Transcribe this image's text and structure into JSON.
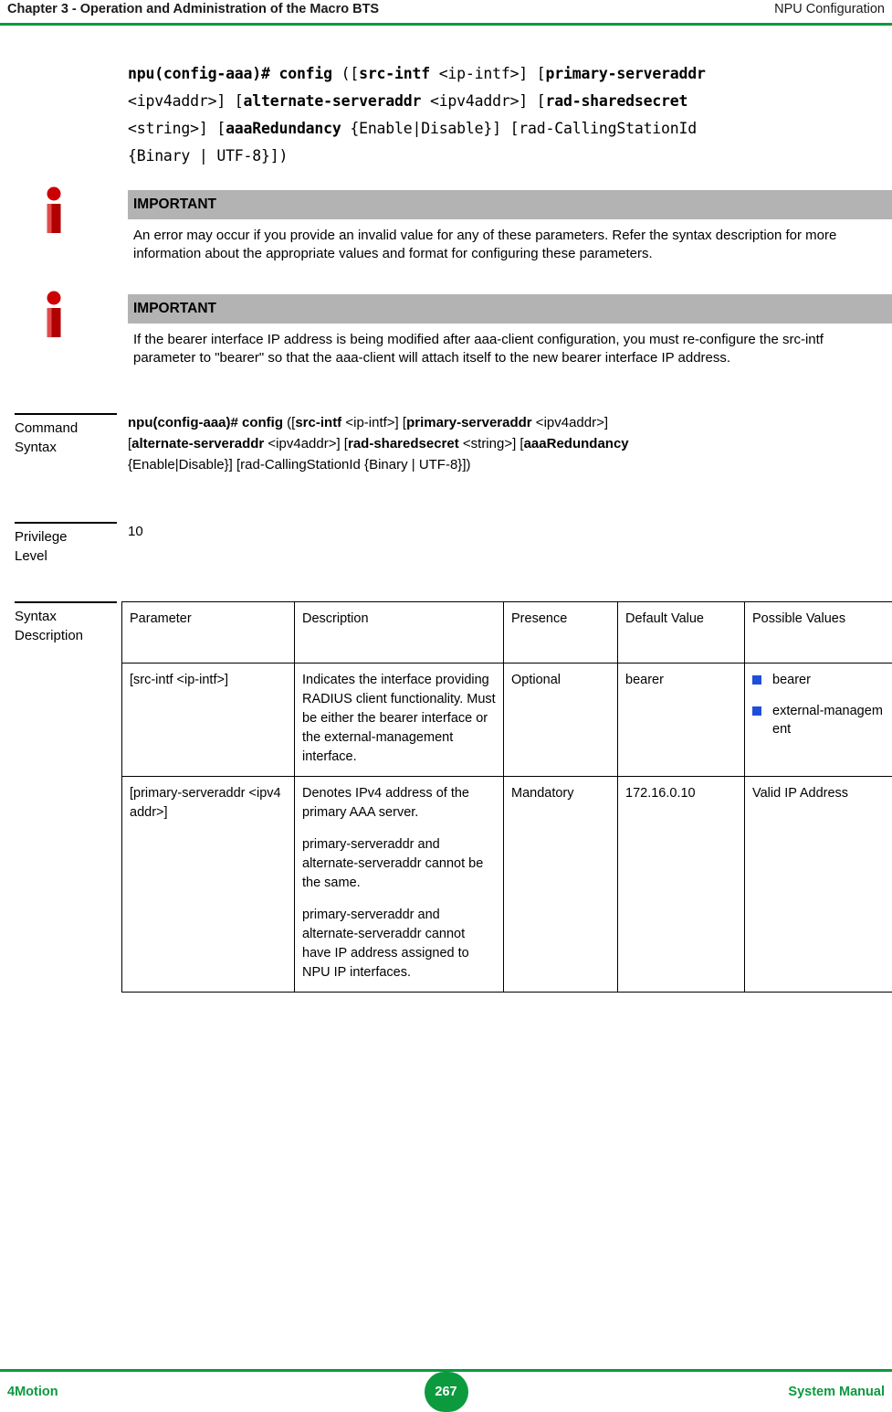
{
  "header": {
    "left": "Chapter 3 - Operation and Administration of the Macro BTS",
    "right": "NPU Configuration"
  },
  "footer": {
    "left": "4Motion",
    "page_number": "267",
    "right": "System Manual"
  },
  "code_block": {
    "line1_a": "npu(config-aaa)# config",
    "line1_b": " ([",
    "line1_c": "src-intf",
    "line1_d": " <ip-intf>] [",
    "line1_e": "primary-serveraddr",
    "line2_a": "<ipv4addr>] [",
    "line2_b": "alternate-serveraddr",
    "line2_c": " <ipv4addr>] [",
    "line2_d": "rad-sharedsecret",
    "line3_a": "<string>] [",
    "line3_b": "aaaRedundancy",
    "line3_c": " {Enable|Disable}] [rad-CallingStationId",
    "line4": "{Binary | UTF-8}])"
  },
  "notes": [
    {
      "title": "IMPORTANT",
      "body": "An error may occur if you provide an invalid value for any of these parameters. Refer the syntax description for more information about the appropriate values and format for configuring these parameters.",
      "icon": "info-icon"
    },
    {
      "title": "IMPORTANT",
      "body": "If the bearer interface IP address is being modified after aaa-client configuration, you must re-configure the src-intf parameter to \"bearer\" so that the aaa-client will attach itself to the new bearer interface IP address.",
      "icon": "info-icon"
    }
  ],
  "sections": {
    "command_syntax": {
      "label_line1": "Command",
      "label_line2": "Syntax",
      "syntax": {
        "s1": "npu(config-aaa)# config",
        "s2": " ([",
        "s3": "src-intf",
        "s4": " <ip-intf>] [",
        "s5": "primary-serveraddr",
        "s6": " <ipv4addr>]",
        "s7": "[",
        "s8": "alternate-serveraddr",
        "s9": " <ipv4addr>] [",
        "s10": "rad-sharedsecret",
        "s11": " <string>] [",
        "s12": "aaaRedundancy",
        "s13": "{Enable|Disable}] [rad-CallingStationId {Binary | UTF-8}])"
      }
    },
    "privilege_level": {
      "label_line1": "Privilege",
      "label_line2": "Level",
      "value": "10"
    },
    "syntax_description": {
      "label_line1": "Syntax",
      "label_line2": "Description"
    }
  },
  "table": {
    "headers": [
      "Parameter",
      "Description",
      "Presence",
      "Default Value",
      "Possible Values"
    ],
    "rows": [
      {
        "parameter": "[src-intf <ip-intf>]",
        "description": [
          "Indicates the interface providing RADIUS client functionality. Must be either the bearer interface or the external-management interface."
        ],
        "presence": "Optional",
        "default_value": "bearer",
        "possible_values": [
          "bearer",
          "external-management"
        ]
      },
      {
        "parameter": "[primary-serveraddr <ipv4addr>]",
        "description": [
          "Denotes IPv4 address of the primary AAA server.",
          "primary-serveraddr and alternate-serveraddr cannot be the same.",
          "primary-serveraddr and alternate-serveraddr cannot have IP address assigned to NPU IP interfaces."
        ],
        "presence": "Mandatory",
        "default_value": "172.16.0.10",
        "possible_values_text": "Valid IP Address"
      }
    ]
  },
  "colors": {
    "accent_green": "#0c9a3e",
    "note_bar": "#b3b3b3",
    "bullet_blue": "#1f4fd8"
  }
}
